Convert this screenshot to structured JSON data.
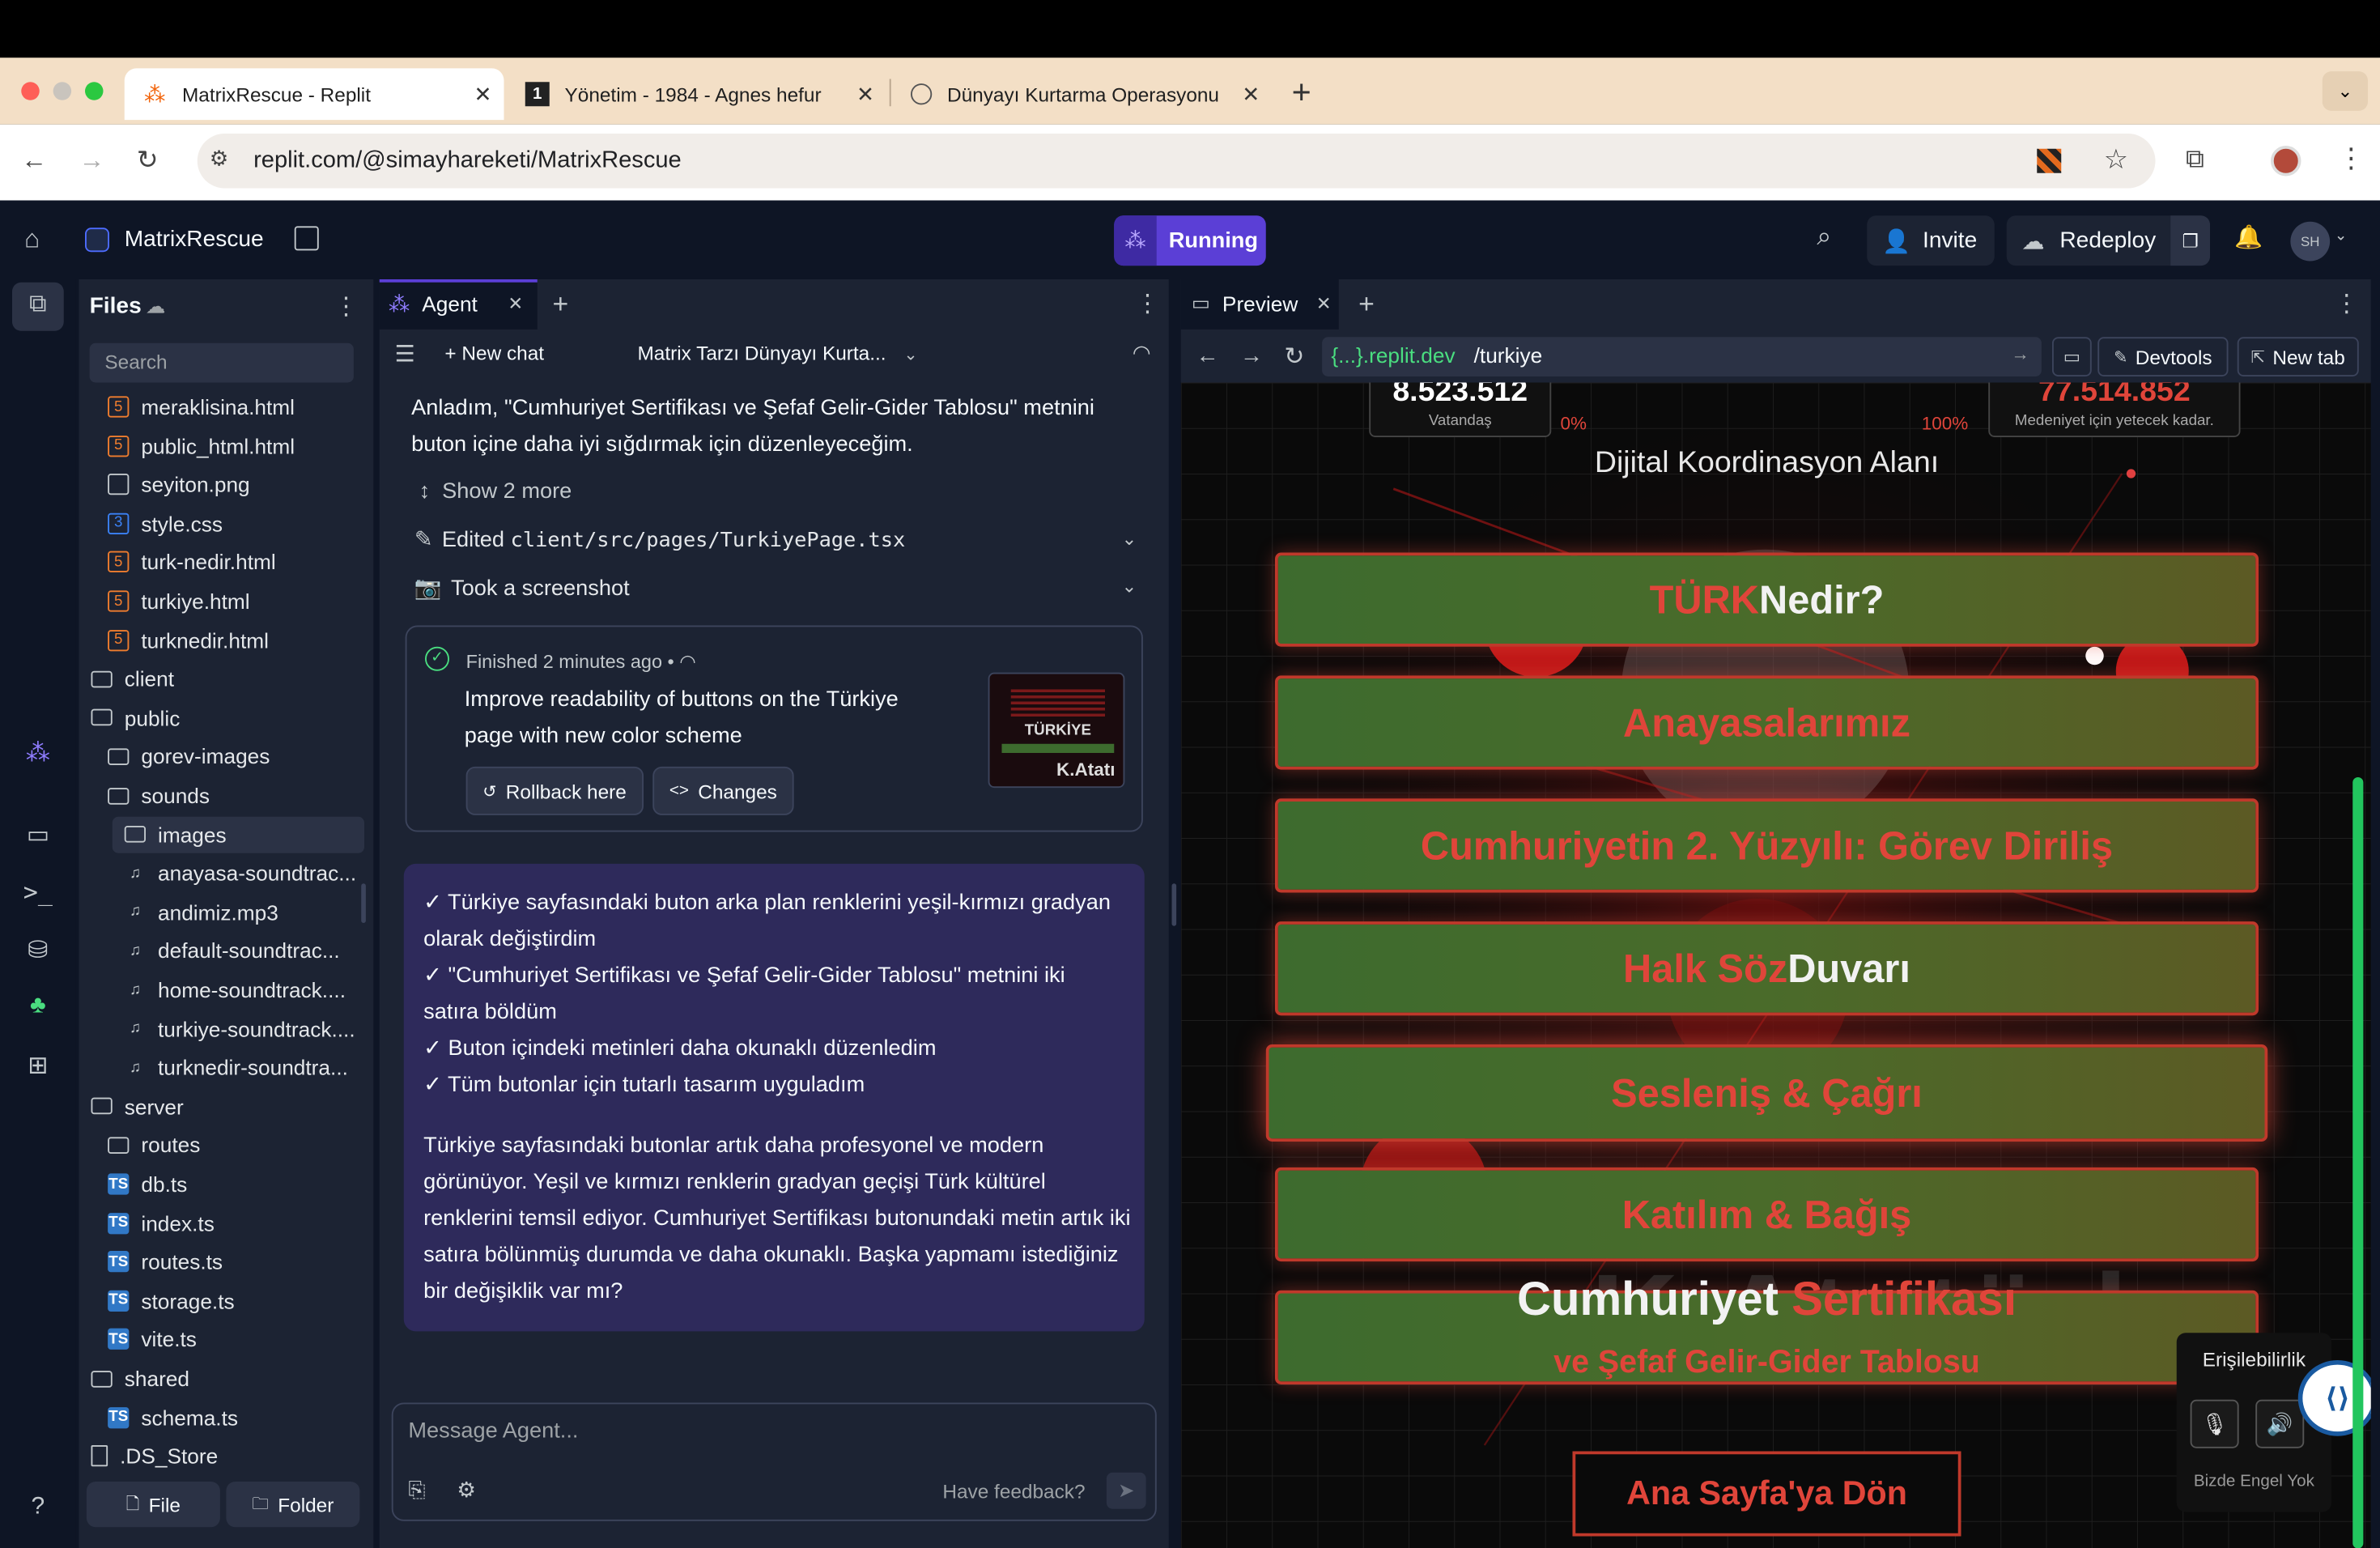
{
  "browser": {
    "tabs": [
      {
        "title": "MatrixRescue - Replit",
        "active": true
      },
      {
        "title": "Yönetim - 1984 - Agnes hefur",
        "active": false
      },
      {
        "title": "Dünyayı Kurtarma Operasyonu",
        "active": false
      }
    ],
    "url": "replit.com/@simayhareketi/MatrixRescue"
  },
  "topbar": {
    "project_name": "MatrixRescue",
    "run_status": "Running",
    "invite_label": "Invite",
    "redeploy_label": "Redeploy",
    "avatar_initials": "SH"
  },
  "files": {
    "title": "Files",
    "search_placeholder": "Search",
    "items": [
      {
        "name": "meraklisina.html",
        "type": "html",
        "depth": 1
      },
      {
        "name": "public_html.html",
        "type": "html",
        "depth": 1
      },
      {
        "name": "seyiton.png",
        "type": "image",
        "depth": 1
      },
      {
        "name": "style.css",
        "type": "css",
        "depth": 1
      },
      {
        "name": "turk-nedir.html",
        "type": "html",
        "depth": 1
      },
      {
        "name": "turkiye.html",
        "type": "html",
        "depth": 1
      },
      {
        "name": "turknedir.html",
        "type": "html",
        "depth": 1
      },
      {
        "name": "client",
        "type": "folder",
        "depth": 0
      },
      {
        "name": "public",
        "type": "folder",
        "depth": 0
      },
      {
        "name": "gorev-images",
        "type": "folder",
        "depth": 1
      },
      {
        "name": "sounds",
        "type": "folder",
        "depth": 1
      },
      {
        "name": "images",
        "type": "folder",
        "depth": 2,
        "selected": true
      },
      {
        "name": "anayasa-soundtrac...",
        "type": "audio",
        "depth": 2
      },
      {
        "name": "andimiz.mp3",
        "type": "audio",
        "depth": 2
      },
      {
        "name": "default-soundtrac...",
        "type": "audio",
        "depth": 2
      },
      {
        "name": "home-soundtrack....",
        "type": "audio",
        "depth": 2
      },
      {
        "name": "turkiye-soundtrack....",
        "type": "audio",
        "depth": 2
      },
      {
        "name": "turknedir-soundtra...",
        "type": "audio",
        "depth": 2
      },
      {
        "name": "server",
        "type": "folder",
        "depth": 0
      },
      {
        "name": "routes",
        "type": "folder",
        "depth": 1
      },
      {
        "name": "db.ts",
        "type": "ts",
        "depth": 1
      },
      {
        "name": "index.ts",
        "type": "ts",
        "depth": 1
      },
      {
        "name": "routes.ts",
        "type": "ts",
        "depth": 1
      },
      {
        "name": "storage.ts",
        "type": "ts",
        "depth": 1
      },
      {
        "name": "vite.ts",
        "type": "ts",
        "depth": 1
      },
      {
        "name": "shared",
        "type": "folder",
        "depth": 0
      },
      {
        "name": "schema.ts",
        "type": "ts",
        "depth": 1
      },
      {
        "name": ".DS_Store",
        "type": "file",
        "depth": 0
      }
    ],
    "new_file_label": "File",
    "new_folder_label": "Folder"
  },
  "agent": {
    "tab_label": "Agent",
    "new_chat_label": "New chat",
    "chat_title": "Matrix Tarzı Dünyayı Kurta...",
    "intro_text": "Anladım, \"Cumhuriyet Sertifikası ve Şefaf Gelir-Gider Tablosu\" metnini buton içine daha iyi sığdırmak için düzenleyeceğim.",
    "show_more": "Show 2 more",
    "edited_prefix": "Edited ",
    "edited_file": "client/src/pages/TurkiyePage.tsx",
    "screenshot_label": "Took a screenshot",
    "finished_label": "Finished",
    "finished_time": "2 minutes ago",
    "finished_desc": "Improve readability of buttons on the Türkiye page with new color scheme",
    "rollback_label": "Rollback here",
    "changes_label": "Changes",
    "thumb_text": "TÜRKİYE",
    "thumb_signature": "K.Atatı",
    "bullets": [
      "✓ Türkiye sayfasındaki buton arka plan renklerini yeşil-kırmızı gradyan olarak değiştirdim",
      "✓ \"Cumhuriyet Sertifikası ve Şefaf Gelir-Gider Tablosu\" metnini iki satıra böldüm",
      "✓ Buton içindeki metinleri daha okunaklı düzenledim",
      "✓ Tüm butonlar için tutarlı tasarım uyguladım"
    ],
    "summary": "Türkiye sayfasındaki butonlar artık daha profesyonel ve modern görünüyor. Yeşil ve kırmızı renklerin gradyan geçişi Türk kültürel renklerini temsil ediyor. Cumhuriyet Sertifikası butonundaki metin artık iki satıra bölünmüş durumda ve daha okunaklı. Başka yapmamı istediğiniz bir değişiklik var mı?",
    "input_placeholder": "Message Agent...",
    "feedback_label": "Have feedback?"
  },
  "preview": {
    "tab_label": "Preview",
    "domain": "{...}.replit.dev",
    "path": "/turkiye",
    "devtools_label": "Devtools",
    "newtab_label": "New tab",
    "stat_left_number": "8.523.512",
    "stat_left_label": "Vatandaş",
    "pct_left": "0%",
    "pct_right": "100%",
    "stat_right_number": "77.514.852",
    "stat_right_label": "Medeniyet için yetecek kadar.",
    "section_title": "Dijital Koordinasyon Alanı",
    "buttons": [
      {
        "part1": "TÜRK",
        "part2": " Nedir?"
      },
      {
        "part1": "Anayasalarımız",
        "part2": ""
      },
      {
        "part1": "Cumhuriyetin 2. Yüzyılı: Görev Diriliş",
        "part2": ""
      },
      {
        "part1": "Halk Söz",
        "part2": " Duvarı"
      },
      {
        "part1": "Sesleniş & Çağrı",
        "part2": ""
      },
      {
        "part1": "Katılım & Bağış",
        "part2": ""
      }
    ],
    "cert_line1a": "Cumhuriyet",
    "cert_line1b": " Sertifikası",
    "cert_line2": "ve Şefaf Gelir-Gider Tablosu",
    "watermark": "K.Atatürk",
    "home_button": "Ana Sayfa'ya Dön",
    "access_title": "Erişilebilirlik",
    "access_footer": "Bizde Engel Yok"
  },
  "colors": {
    "replit_bg": "#0e1525",
    "panel_bg": "#1c2333",
    "running_purple": "#5b3fd6",
    "button_red": "#e0453a",
    "button_green": "#3d6b2e"
  }
}
